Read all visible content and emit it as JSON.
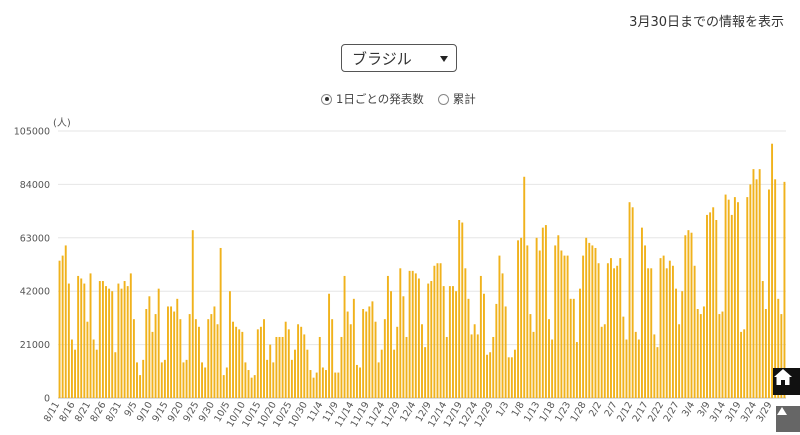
{
  "header": {
    "info_text": "3月30日までの情報を表示"
  },
  "select": {
    "value": "ブラジル"
  },
  "radios": [
    {
      "label": "1日ごとの発表数",
      "checked": true
    },
    {
      "label": "累計",
      "checked": false
    }
  ],
  "chart_data": {
    "type": "bar",
    "unit": "(人)",
    "color": "#f0b21c",
    "grid": true,
    "ylim": [
      0,
      105000
    ],
    "yticks": [
      0,
      21000,
      42000,
      63000,
      84000,
      105000
    ],
    "x_tick_labels": [
      "8/11",
      "8/16",
      "8/21",
      "8/26",
      "8/31",
      "9/5",
      "9/10",
      "9/15",
      "9/20",
      "9/25",
      "9/30",
      "10/5",
      "10/10",
      "10/15",
      "10/20",
      "10/25",
      "10/30",
      "11/4",
      "11/9",
      "11/14",
      "11/19",
      "11/24",
      "11/29",
      "12/4",
      "12/9",
      "12/14",
      "12/19",
      "12/24",
      "12/29",
      "1/3",
      "1/8",
      "1/13",
      "1/18",
      "1/23",
      "1/28",
      "2/2",
      "2/7",
      "2/12",
      "2/17",
      "2/22",
      "2/27",
      "3/4",
      "3/9",
      "3/14",
      "3/19",
      "3/24",
      "3/29"
    ],
    "start_date": "2020-08-11",
    "values": [
      54000,
      56000,
      60000,
      45000,
      23000,
      19000,
      48000,
      47000,
      45000,
      30000,
      49000,
      23000,
      19000,
      46000,
      46000,
      44000,
      43000,
      42000,
      18000,
      45000,
      43000,
      46000,
      44000,
      49000,
      31000,
      14000,
      9000,
      15000,
      35000,
      40000,
      26000,
      33000,
      43000,
      14000,
      15000,
      36000,
      36000,
      34000,
      39000,
      31000,
      14000,
      15000,
      33000,
      66000,
      31000,
      28000,
      14000,
      12000,
      31000,
      33000,
      36000,
      29000,
      59000,
      9000,
      12000,
      42000,
      30000,
      28000,
      27000,
      26000,
      14000,
      11000,
      8000,
      9000,
      27000,
      28000,
      31000,
      15000,
      21000,
      14000,
      24000,
      24000,
      24000,
      30000,
      27000,
      15000,
      19000,
      29000,
      28000,
      25000,
      19000,
      11000,
      8000,
      10000,
      24000,
      12000,
      11000,
      41000,
      31000,
      10000,
      10000,
      24000,
      48000,
      34000,
      29000,
      39000,
      13000,
      12000,
      35000,
      34000,
      36000,
      38000,
      30000,
      14000,
      19000,
      31000,
      48000,
      42000,
      19000,
      28000,
      51000,
      40000,
      24000,
      50000,
      50000,
      49000,
      47000,
      29000,
      20000,
      45000,
      46000,
      52000,
      53000,
      53000,
      44000,
      24000,
      44000,
      44000,
      42000,
      70000,
      69000,
      51000,
      39000,
      25000,
      29000,
      25000,
      48000,
      41000,
      17000,
      18000,
      24000,
      37000,
      56000,
      49000,
      36000,
      16000,
      16000,
      19000,
      62000,
      63000,
      87000,
      60000,
      33000,
      26000,
      63000,
      58000,
      67000,
      68000,
      31000,
      23000,
      60000,
      64000,
      58000,
      56000,
      56000,
      39000,
      39000,
      22000,
      43000,
      56000,
      63000,
      61000,
      60000,
      59000,
      53000,
      28000,
      29000,
      53000,
      55000,
      51000,
      52000,
      55000,
      32000,
      23000,
      77000,
      75000,
      26000,
      23000,
      67000,
      60000,
      51000,
      51000,
      25000,
      20000,
      55000,
      56000,
      51000,
      54000,
      52000,
      43000,
      29000,
      42000,
      64000,
      66000,
      65000,
      52000,
      35000,
      33000,
      36000,
      72000,
      73000,
      75000,
      70000,
      33000,
      34000,
      80000,
      78000,
      72000,
      79000,
      77000,
      26000,
      27000,
      79000,
      84000,
      90000,
      86000,
      90000,
      46000,
      35000,
      82000,
      100000,
      86000,
      39000,
      33000,
      85000
    ]
  }
}
